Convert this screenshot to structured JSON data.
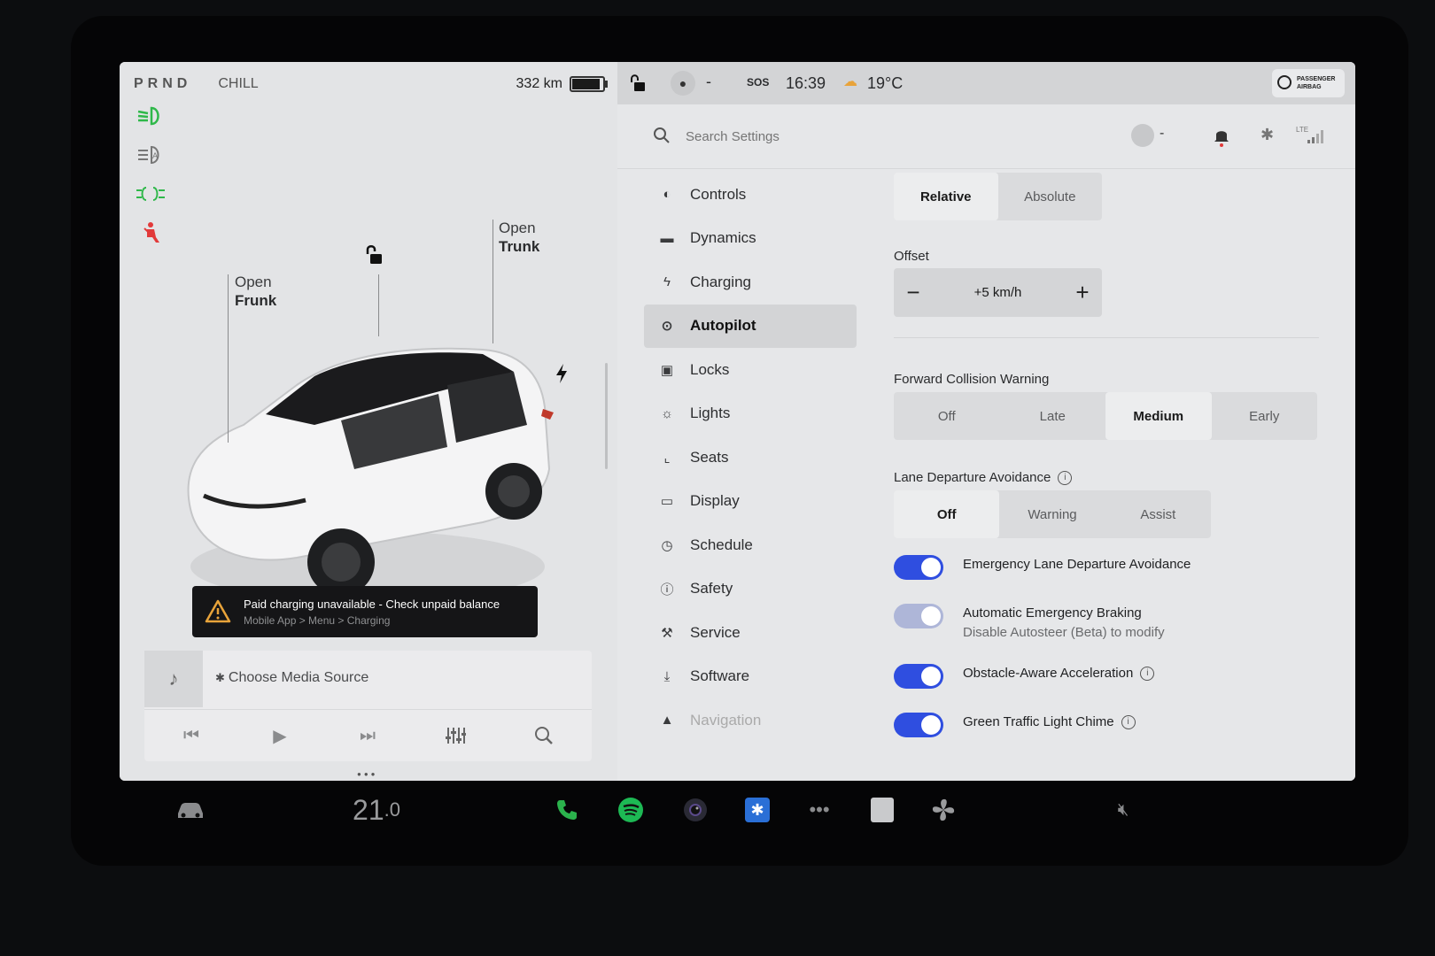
{
  "status_left": {
    "gear": "PRND",
    "mode": "CHILL",
    "range": "332 km"
  },
  "car": {
    "open_frunk_line1": "Open",
    "open_frunk_line2": "Frunk",
    "open_trunk_line1": "Open",
    "open_trunk_line2": "Trunk",
    "battery_level": 0.85
  },
  "alert": {
    "title": "Paid charging unavailable - Check unpaid balance",
    "path": "Mobile App > Menu > Charging"
  },
  "media": {
    "source_label": "Choose Media Source"
  },
  "topbar": {
    "sos": "SOS",
    "time": "16:39",
    "temperature": "19°C",
    "profile_dash": "-",
    "airbag_line1": "PASSENGER",
    "airbag_line2": "AIRBAG"
  },
  "search": {
    "placeholder": "Search Settings",
    "profile_dash": "-",
    "lte": "LTE"
  },
  "nav": [
    {
      "label": "Controls",
      "icon": "toggle-icon"
    },
    {
      "label": "Dynamics",
      "icon": "car-icon"
    },
    {
      "label": "Charging",
      "icon": "bolt-icon"
    },
    {
      "label": "Autopilot",
      "icon": "steering-wheel-icon"
    },
    {
      "label": "Locks",
      "icon": "lock-icon"
    },
    {
      "label": "Lights",
      "icon": "sun-icon"
    },
    {
      "label": "Seats",
      "icon": "seat-icon"
    },
    {
      "label": "Display",
      "icon": "display-icon"
    },
    {
      "label": "Schedule",
      "icon": "clock-icon"
    },
    {
      "label": "Safety",
      "icon": "info-circle-icon"
    },
    {
      "label": "Service",
      "icon": "wrench-icon"
    },
    {
      "label": "Software",
      "icon": "download-icon"
    },
    {
      "label": "Navigation",
      "icon": "navigation-icon"
    }
  ],
  "autopilot": {
    "speed_mode": {
      "options": [
        "Relative",
        "Absolute"
      ],
      "selected": "Relative"
    },
    "offset_label": "Offset",
    "offset_value": "+5 km/h",
    "fcw_label": "Forward Collision Warning",
    "fcw": {
      "options": [
        "Off",
        "Late",
        "Medium",
        "Early"
      ],
      "selected": "Medium"
    },
    "lda_label": "Lane Departure Avoidance",
    "lda": {
      "options": [
        "Off",
        "Warning",
        "Assist"
      ],
      "selected": "Off"
    },
    "toggles": [
      {
        "label": "Emergency Lane Departure Avoidance",
        "on": true
      },
      {
        "label": "Automatic Emergency Braking",
        "sub": "Disable Autosteer (Beta) to modify",
        "on": true,
        "disabled": true
      },
      {
        "label": "Obstacle-Aware Acceleration",
        "on": true
      },
      {
        "label": "Green Traffic Light Chime",
        "on": true
      }
    ]
  },
  "dock": {
    "temp_whole": "21",
    "temp_decimal": ".0"
  },
  "colors": {
    "accent_blue": "#2f4ee0",
    "spotify_green": "#1db954",
    "phone_green": "#2bb24c",
    "warning_red": "#e23a3a",
    "lamp_green": "#2fb84a"
  }
}
